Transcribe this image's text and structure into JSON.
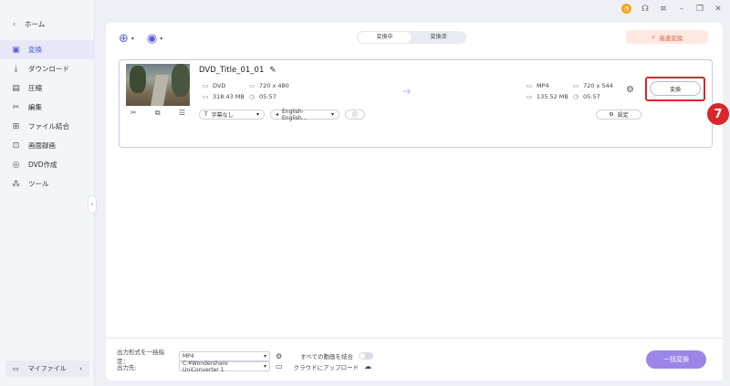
{
  "sidebar": {
    "home_label": "ホーム",
    "items": [
      {
        "label": "変換",
        "icon": "convert-icon"
      },
      {
        "label": "ダウンロード",
        "icon": "download-icon"
      },
      {
        "label": "圧縮",
        "icon": "compress-icon"
      },
      {
        "label": "編集",
        "icon": "edit-scissors-icon"
      },
      {
        "label": "ファイル結合",
        "icon": "merge-icon"
      },
      {
        "label": "画面録画",
        "icon": "screen-record-icon"
      },
      {
        "label": "DVD作成",
        "icon": "dvd-icon"
      },
      {
        "label": "ツール",
        "icon": "toolbox-icon"
      }
    ],
    "my_files_label": "マイファイル"
  },
  "tabs": {
    "converting": "変換中",
    "converted": "変換済"
  },
  "fast_convert_label": "高速変換",
  "file": {
    "title": "DVD_Title_01_01",
    "source": {
      "format": "DVD",
      "resolution": "720 x 480",
      "size": "318.43 MB",
      "duration": "05:57"
    },
    "target": {
      "format": "MP4",
      "resolution": "720 x 544",
      "size": "135.52 MB",
      "duration": "05:57"
    },
    "convert_button": "変換",
    "subtitle_option": "字幕なし",
    "audio_option": "English-English...",
    "settings_label": "設定",
    "step_badge": "7"
  },
  "bottom": {
    "output_format_label": "出力形式を一括指定：",
    "output_format_value": "MP4",
    "merge_label": "すべての動画を結合",
    "output_dir_label": "出力先:",
    "output_dir_value": "C:¥Wondershare UniConverter 1",
    "upload_label": "クラウドにアップロード",
    "bulk_convert_label": "一括変換"
  },
  "colors": {
    "accent": "#5b5fd8",
    "highlight_red": "#d9262c",
    "bulk_button": "#9b86e8"
  }
}
